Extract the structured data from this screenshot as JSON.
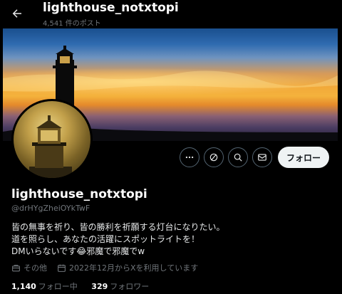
{
  "header": {
    "title": "lighthouse_notxtopi",
    "post_count": "4,541 件のポスト"
  },
  "profile": {
    "display_name": "lighthouse_notxtopi",
    "handle": "@drHYgZheiOYkTwF",
    "bio_lines": [
      "皆の無事を祈り、皆の勝利を祈願する灯台になりたい。",
      "道を照らし、あなたの活躍にスポットライトを！",
      "DMいらないです😂邪魔で邪魔でw"
    ],
    "category": "その他",
    "joined": "2022年12月からXを利用しています",
    "following_count": "1,140",
    "following_label": "フォロー中",
    "followers_count": "329",
    "followers_label": "フォロワー"
  },
  "actions": {
    "follow_label": "フォロー"
  },
  "icons": {
    "back": "arrow-left-icon",
    "more": "more-icon",
    "grok": "grok-icon",
    "search": "search-icon",
    "message": "mail-icon",
    "category": "briefcase-icon",
    "calendar": "calendar-icon"
  },
  "colors": {
    "background": "#000000",
    "text": "#e7e9ea",
    "muted": "#71767b",
    "follow_button_bg": "#eff3f4"
  }
}
